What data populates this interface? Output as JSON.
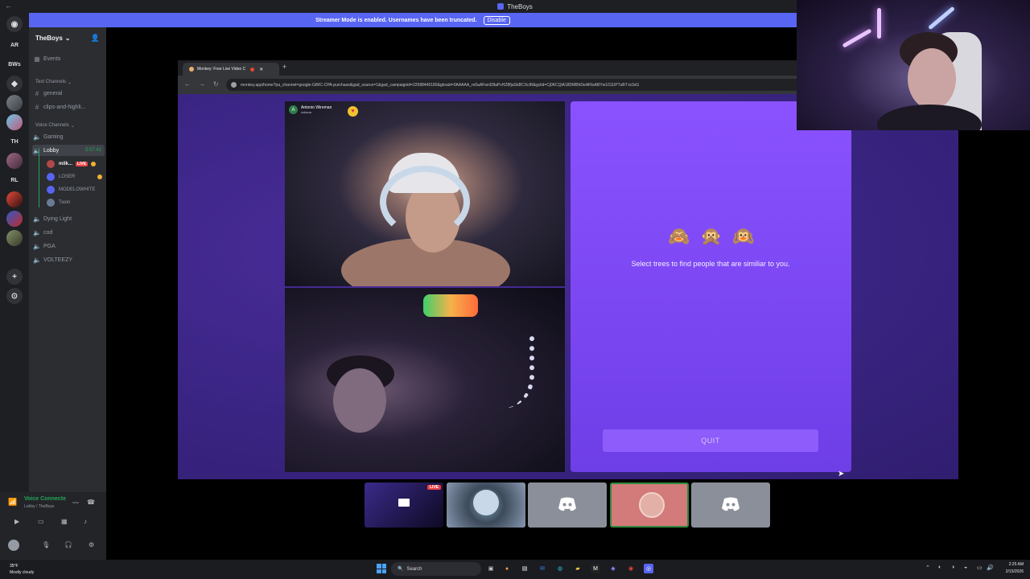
{
  "window": {
    "title": "TheBoys",
    "back_label": "←"
  },
  "banner": {
    "text": "Streamer Mode is enabled. Usernames have been truncated.",
    "disable_label": "Disable"
  },
  "rail": {
    "items": [
      {
        "label": "AR"
      },
      {
        "label": "BWs"
      },
      {
        "label": "TH"
      },
      {
        "label": "RL"
      }
    ]
  },
  "sidebar": {
    "server_name": "TheBoys",
    "events_label": "Events",
    "text_category": "Text Channels",
    "text_channels": [
      "general",
      "clips-and-highli..."
    ],
    "voice_category": "Voice Channels",
    "voice_channels_top": [
      "Gaming"
    ],
    "active_channel": {
      "name": "Lobby",
      "timer": "5:07:41"
    },
    "voice_users": [
      {
        "name": "milk...",
        "live": "LIVE"
      },
      {
        "name": "LOSER"
      },
      {
        "name": "MODELOWHITE"
      },
      {
        "name": "Twon"
      }
    ],
    "voice_channels_bottom": [
      "Dying Light",
      "cod",
      "PGA",
      "VOLTEEZY"
    ]
  },
  "voice_panel": {
    "title": "Voice Connecte",
    "subtitle": "Lobby / TheBoys"
  },
  "browser": {
    "tab_title": "Monkey: Free Live Video C",
    "new_tab": "+",
    "url": "monkey.app/home?pa_channel=google-GIMC-CPA-purchase&gad_source=1&gad_campaignid=22588445180&gbraid=0AAAAA_re0aAFwnD8aPvHZ8fjuGkBCXctN&gclid=Cj0KCQiA18DMBhDeARIsABYw1011IP7uBT-tz3xG",
    "cam_name": "Antonio Wireman",
    "cam_location": "indiana",
    "cam_avatar": "A",
    "prompt": "Select trees to find people that are similiar to you.",
    "quit_label": "QUIT"
  },
  "tiles": {
    "live_label": "LIVE"
  },
  "taskbar": {
    "weather_temp": "35°F",
    "weather_desc": "Mostly cloudy",
    "search_label": "Search",
    "time": "2:25 AM",
    "date": "2/15/2026"
  },
  "colors": {
    "discord_blurple": "#5865f2",
    "monkey_purple": "#8a52ff",
    "live_red": "#ed4245",
    "voice_green": "#23a55a"
  }
}
